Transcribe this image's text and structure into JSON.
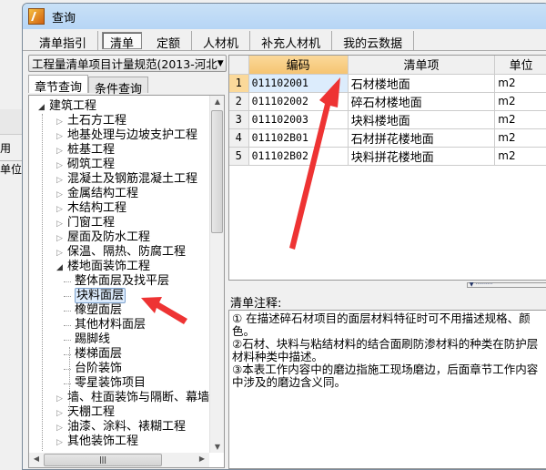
{
  "background_window": {
    "label1": "用",
    "label2": "单位"
  },
  "window": {
    "title": "查询",
    "app_icon": "app-logo-icon"
  },
  "tabs": [
    {
      "label": "清单指引",
      "active": false
    },
    {
      "label": "清单",
      "active": true
    },
    {
      "label": "定额",
      "active": false
    },
    {
      "label": "人材机",
      "active": false
    },
    {
      "label": "补充人材机",
      "active": false
    },
    {
      "label": "我的云数据",
      "active": false
    }
  ],
  "left": {
    "spec_select": "工程量清单项目计量规范(2013-河北",
    "subtabs": [
      {
        "label": "章节查询",
        "active": true
      },
      {
        "label": "条件查询",
        "active": false
      }
    ],
    "tree": [
      {
        "label": "建筑工程",
        "level": 0,
        "state": "open"
      },
      {
        "label": "土石方工程",
        "level": 1,
        "state": "closed"
      },
      {
        "label": "地基处理与边坡支护工程",
        "level": 1,
        "state": "closed"
      },
      {
        "label": "桩基工程",
        "level": 1,
        "state": "closed"
      },
      {
        "label": "砌筑工程",
        "level": 1,
        "state": "closed"
      },
      {
        "label": "混凝土及钢筋混凝土工程",
        "level": 1,
        "state": "closed"
      },
      {
        "label": "金属结构工程",
        "level": 1,
        "state": "closed"
      },
      {
        "label": "木结构工程",
        "level": 1,
        "state": "closed"
      },
      {
        "label": "门窗工程",
        "level": 1,
        "state": "closed"
      },
      {
        "label": "屋面及防水工程",
        "level": 1,
        "state": "closed"
      },
      {
        "label": "保温、隔热、防腐工程",
        "level": 1,
        "state": "closed"
      },
      {
        "label": "楼地面装饰工程",
        "level": 1,
        "state": "open"
      },
      {
        "label": "整体面层及找平层",
        "level": 2,
        "state": "leaf"
      },
      {
        "label": "块料面层",
        "level": 2,
        "state": "leaf",
        "selected": true
      },
      {
        "label": "橡塑面层",
        "level": 2,
        "state": "leaf"
      },
      {
        "label": "其他材料面层",
        "level": 2,
        "state": "leaf"
      },
      {
        "label": "踢脚线",
        "level": 2,
        "state": "leaf"
      },
      {
        "label": "楼梯面层",
        "level": 2,
        "state": "leaf"
      },
      {
        "label": "台阶装饰",
        "level": 2,
        "state": "leaf"
      },
      {
        "label": "零星装饰项目",
        "level": 2,
        "state": "leaf"
      },
      {
        "label": "墙、柱面装饰与隔断、幕墙",
        "level": 1,
        "state": "closed"
      },
      {
        "label": "天棚工程",
        "level": 1,
        "state": "closed"
      },
      {
        "label": "油漆、涂料、裱糊工程",
        "level": 1,
        "state": "closed"
      },
      {
        "label": "其他装饰工程",
        "level": 1,
        "state": "closed"
      }
    ]
  },
  "grid": {
    "columns": [
      "编码",
      "清单项",
      "单位"
    ],
    "rows": [
      {
        "no": "1",
        "code": "011102001",
        "name": "石材楼地面",
        "unit": "m2"
      },
      {
        "no": "2",
        "code": "011102002",
        "name": "碎石材楼地面",
        "unit": "m2"
      },
      {
        "no": "3",
        "code": "011102003",
        "name": "块料楼地面",
        "unit": "m2"
      },
      {
        "no": "4",
        "code": "011102B01",
        "name": "石材拼花楼地面",
        "unit": "m2"
      },
      {
        "no": "5",
        "code": "011102B02",
        "name": "块料拼花楼地面",
        "unit": "m2"
      }
    ]
  },
  "notes": {
    "label": "清单注释:",
    "lines": [
      "① 在描述碎石材项目的面层材料特征时可不用描述规格、颜色。",
      "②石材、块料与粘结材料的结合面刷防渗材料的种类在防护层材料种类中描述。",
      "③本表工作内容中的磨边指施工现场磨边，后面章节工作内容中涉及的磨边含义同。"
    ]
  },
  "colors": {
    "header_highlight": "#f5c472",
    "selection": "#dcecfc",
    "annotation_arrow": "#ee3333",
    "titlebar": "#b6d5f5"
  }
}
